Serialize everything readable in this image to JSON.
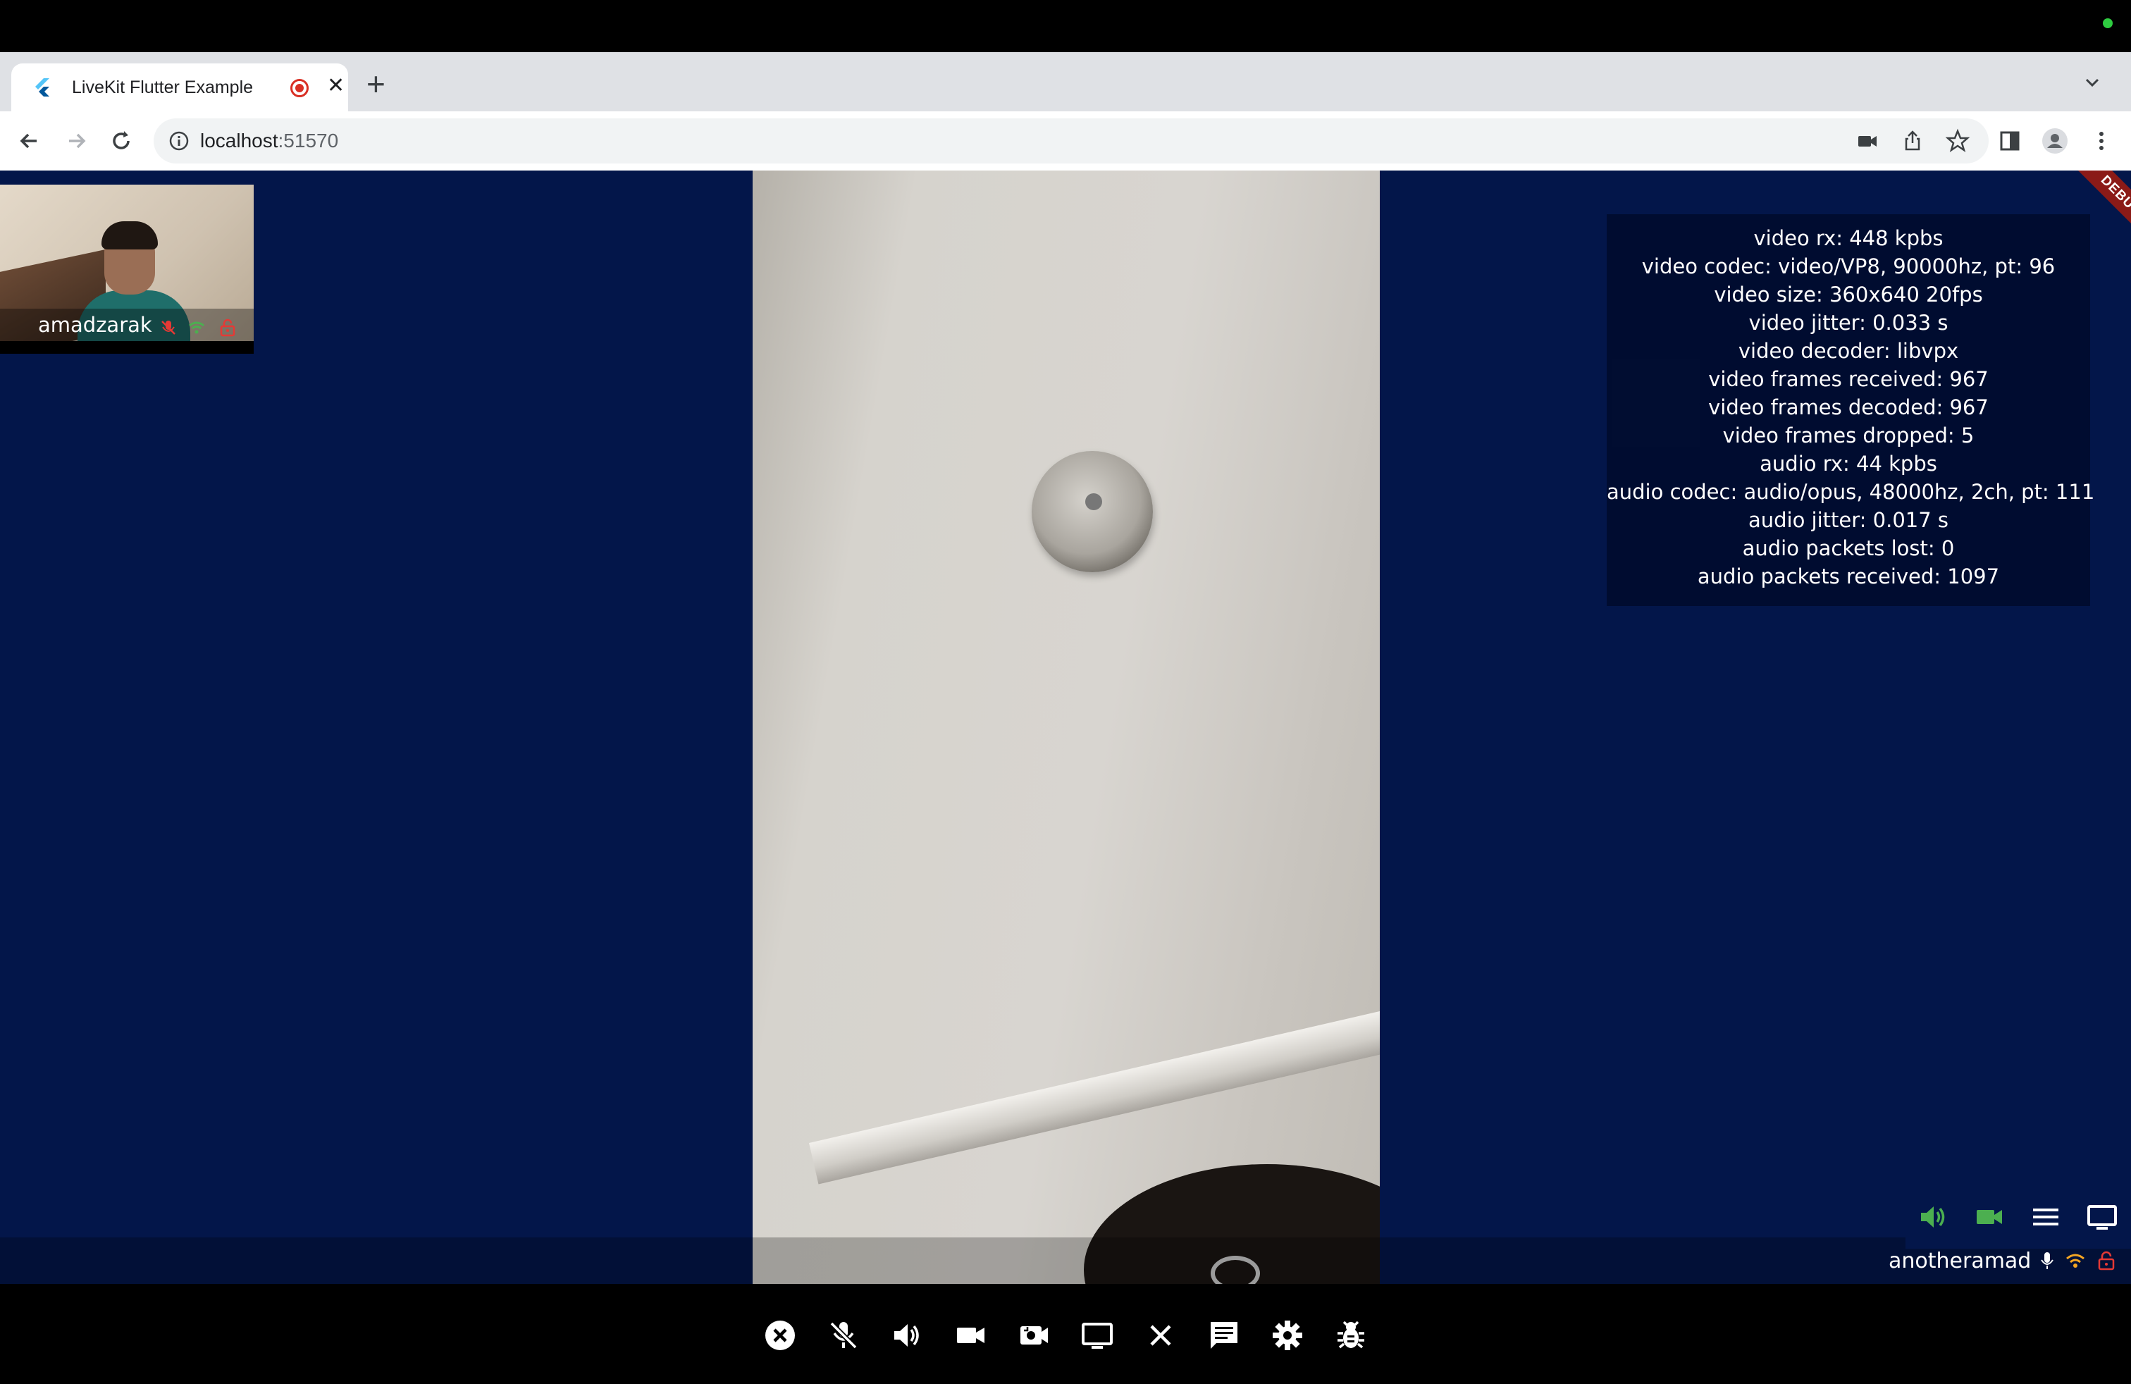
{
  "browser": {
    "tab_title": "LiveKit Flutter Example",
    "url_host": "localhost",
    "url_port": ":51570"
  },
  "local_participant": {
    "name": "amadzarak"
  },
  "remote_participant": {
    "name": "anotheramad"
  },
  "stats": {
    "lines": [
      "video rx: 448 kpbs",
      "video codec: video/VP8, 90000hz, pt: 96",
      "video size: 360x640 20fps",
      "video jitter: 0.033 s",
      "video decoder: libvpx",
      "video frames received: 967",
      "video frames decoded: 967",
      "video frames dropped: 5",
      "audio rx: 44 kpbs",
      "audio codec: audio/opus, 48000hz, 2ch, pt: 111",
      "audio jitter: 0.017 s",
      "audio packets lost: 0",
      "audio packets received: 1097"
    ]
  },
  "debug_banner": "DEBUG",
  "colors": {
    "app_background": "#03164a",
    "active_green": "#4caf50",
    "muted_red": "#e53935",
    "signal_orange": "#f5a623"
  },
  "controls": [
    "disconnect-icon",
    "mic-off-icon",
    "speaker-icon",
    "camera-icon",
    "switch-camera-icon",
    "screen-share-icon",
    "close-icon",
    "chat-icon",
    "settings-icon",
    "debug-bug-icon"
  ]
}
